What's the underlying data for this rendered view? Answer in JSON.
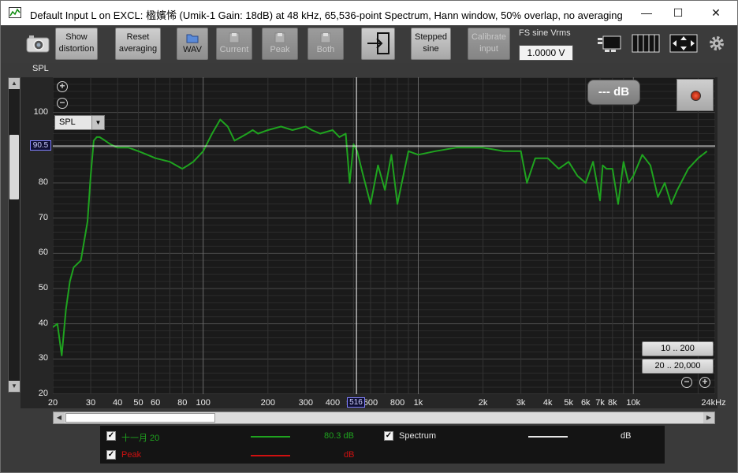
{
  "window": {
    "title": "Default Input L on EXCL: 楹嬪悕 (Umik-1  Gain: 18dB) at 48 kHz, 65,536-point Spectrum, Hann window, 50% overlap, no averaging",
    "minimize": "—",
    "maximize": "☐",
    "close": "✕"
  },
  "toolbar": {
    "show_distortion": "Show distortion",
    "reset_averaging": "Reset averaging",
    "wav": "WAV",
    "current": "Current",
    "peak": "Peak",
    "both": "Both",
    "stepped_sine": "Stepped sine",
    "calibrate_input": "Calibrate input",
    "fs_label": "FS sine Vrms",
    "fs_value": "1.0000 V"
  },
  "plot": {
    "y_axis_label": "SPL",
    "measure_select": "SPL",
    "cursor_y": "90.5",
    "cursor_x": "516",
    "db_readout": "--- dB",
    "range_btn_1": "10 .. 200",
    "range_btn_2": "20 .. 20,000",
    "grid_color": "#4a4a4a",
    "trace_color": "#1fa31f",
    "cursor_color": "#ffffff"
  },
  "legend": {
    "series1_name": "十一月 20",
    "series1_value": "80.3 dB",
    "series1_color": "#1fa31f",
    "spectrum_label": "Spectrum",
    "spectrum_value": "dB",
    "peak_label": "Peak",
    "peak_value": "dB",
    "peak_color": "#d01010"
  },
  "chart_data": {
    "type": "line",
    "title": "",
    "xlabel": "",
    "ylabel": "SPL",
    "x_scale": "log",
    "xlim": [
      20,
      24000
    ],
    "ylim": [
      20,
      110
    ],
    "y_ticks": [
      20,
      30,
      40,
      50,
      60,
      70,
      80,
      90,
      100
    ],
    "x_ticks": [
      "20",
      "30",
      "40",
      "50",
      "60",
      "80",
      "100",
      "200",
      "300",
      "400",
      "500",
      "600",
      "800",
      "1k",
      "2k",
      "3k",
      "4k",
      "5k",
      "6k",
      "7k",
      "8k",
      "10k",
      "24kHz"
    ],
    "cursor": {
      "x": 516,
      "y": 90.5
    },
    "series": [
      {
        "name": "十一月 20",
        "x": [
          20,
          21,
          22,
          23,
          24,
          25,
          27,
          29,
          30,
          31,
          32,
          33,
          35,
          37,
          40,
          45,
          50,
          55,
          60,
          70,
          80,
          85,
          90,
          100,
          110,
          120,
          130,
          140,
          150,
          160,
          170,
          180,
          200,
          230,
          260,
          300,
          320,
          350,
          400,
          430,
          460,
          480,
          500,
          520,
          550,
          600,
          650,
          700,
          750,
          800,
          900,
          1000,
          1200,
          1500,
          2000,
          2500,
          3000,
          3200,
          3500,
          4000,
          4500,
          5000,
          5500,
          6000,
          6500,
          7000,
          7200,
          7500,
          8000,
          8500,
          9000,
          9500,
          10000,
          11000,
          12000,
          13000,
          14000,
          15000,
          16000,
          18000,
          20000,
          22000
        ],
        "values": [
          39,
          40,
          31,
          44,
          52,
          56,
          58,
          69,
          82,
          92,
          93,
          93,
          92,
          91,
          90,
          90,
          89,
          88,
          87,
          86,
          84,
          85,
          86,
          89,
          94,
          98,
          96,
          92,
          93,
          94,
          95,
          94,
          95,
          96,
          95,
          96,
          95,
          94,
          95,
          93,
          94,
          80,
          91,
          89,
          83,
          74,
          85,
          78,
          88,
          74,
          89,
          88,
          89,
          90,
          90,
          89,
          89,
          80,
          87,
          87,
          84,
          86,
          82,
          80,
          86,
          75,
          85,
          84,
          84,
          74,
          86,
          80,
          82,
          88,
          85,
          76,
          80,
          74,
          78,
          84,
          87,
          89
        ]
      }
    ]
  }
}
